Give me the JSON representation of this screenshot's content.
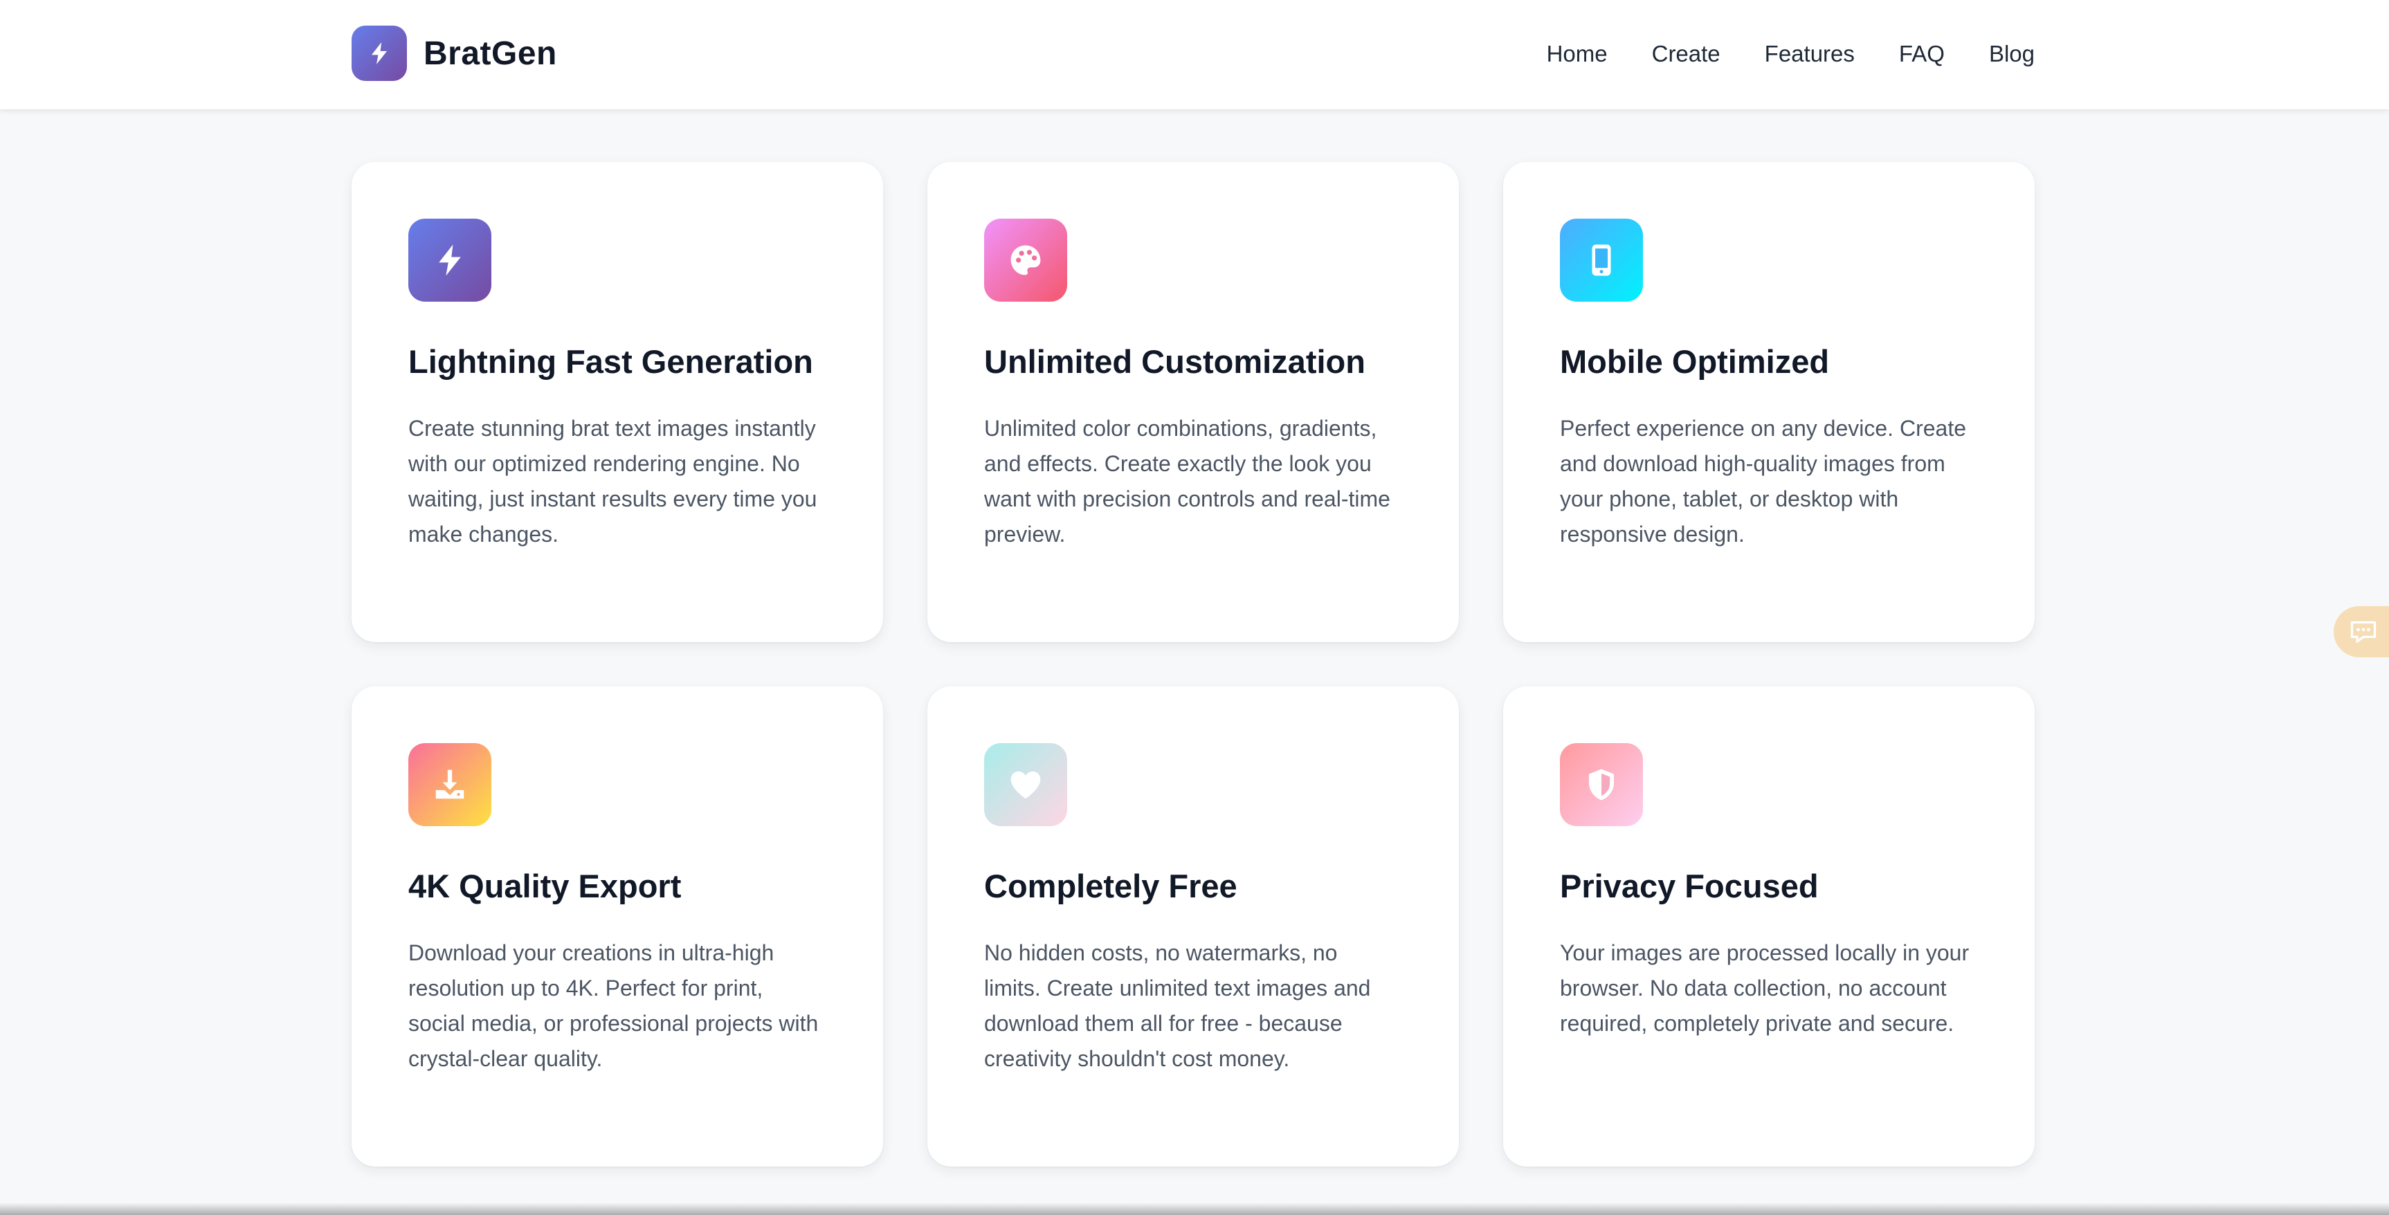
{
  "header": {
    "brand_name": "BratGen",
    "nav": [
      "Home",
      "Create",
      "Features",
      "FAQ",
      "Blog"
    ]
  },
  "features": [
    {
      "icon": "lightning-icon",
      "gradient": [
        "#667eea",
        "#764ba2"
      ],
      "title": "Lightning Fast Generation",
      "desc": "Create stunning brat text images instantly with our optimized rendering engine. No waiting, just instant results every time you make changes."
    },
    {
      "icon": "palette-icon",
      "gradient": [
        "#f093fb",
        "#f5576c"
      ],
      "title": "Unlimited Customization",
      "desc": "Unlimited color combinations, gradients, and effects. Create exactly the look you want with precision controls and real-time preview."
    },
    {
      "icon": "mobile-icon",
      "gradient": [
        "#4facfe",
        "#00f2fe"
      ],
      "title": "Mobile Optimized",
      "desc": "Perfect experience on any device. Create and download high-quality images from your phone, tablet, or desktop with responsive design."
    },
    {
      "icon": "download-icon",
      "gradient": [
        "#fa709a",
        "#fee140"
      ],
      "title": "4K Quality Export",
      "desc": "Download your creations in ultra-high resolution up to 4K. Perfect for print, social media, or professional projects with crystal-clear quality."
    },
    {
      "icon": "heart-icon",
      "gradient": [
        "#a8edea",
        "#fed6e3"
      ],
      "title": "Completely Free",
      "desc": "No hidden costs, no watermarks, no limits. Create unlimited text images and download them all for free - because creativity shouldn't cost money."
    },
    {
      "icon": "shield-icon",
      "gradient": [
        "#ff9a9e",
        "#fecfef"
      ],
      "title": "Privacy Focused",
      "desc": "Your images are processed locally in your browser. No data collection, no account required, completely private and secure."
    }
  ],
  "chat_widget": {
    "icon": "chat-icon",
    "color": "#f6ddb5"
  }
}
